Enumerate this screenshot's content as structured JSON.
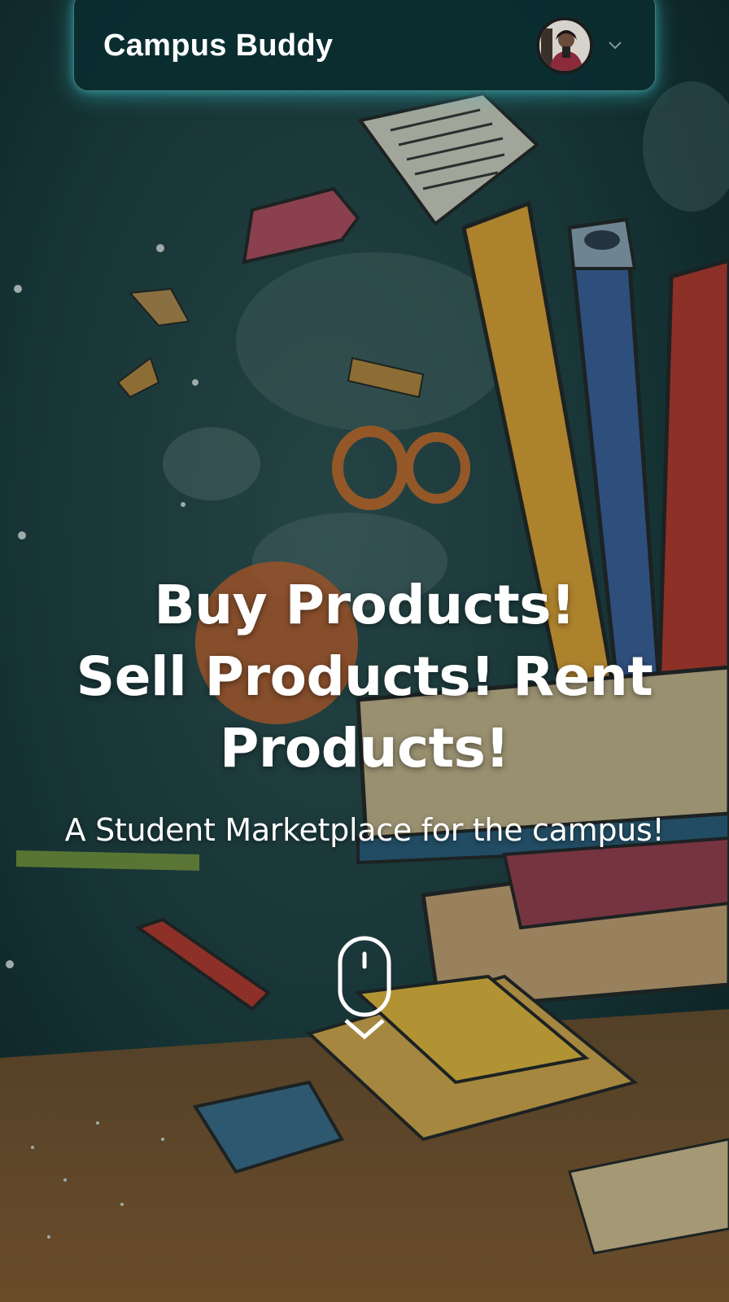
{
  "navbar": {
    "brand": "Campus Buddy",
    "avatar_icon": "user-avatar",
    "dropdown_icon": "chevron-down-icon"
  },
  "hero": {
    "headline_lines": [
      "Buy Products!",
      "Sell Products! Rent",
      "Products!"
    ],
    "subtitle": "A Student Marketplace for the campus!",
    "scroll_icon": "mouse-scroll-down-icon"
  },
  "colors": {
    "background": "#0f2a2c",
    "navbar_bg": "#0a2d30",
    "navbar_glow": "#3cc8d2",
    "text": "#ffffff"
  }
}
